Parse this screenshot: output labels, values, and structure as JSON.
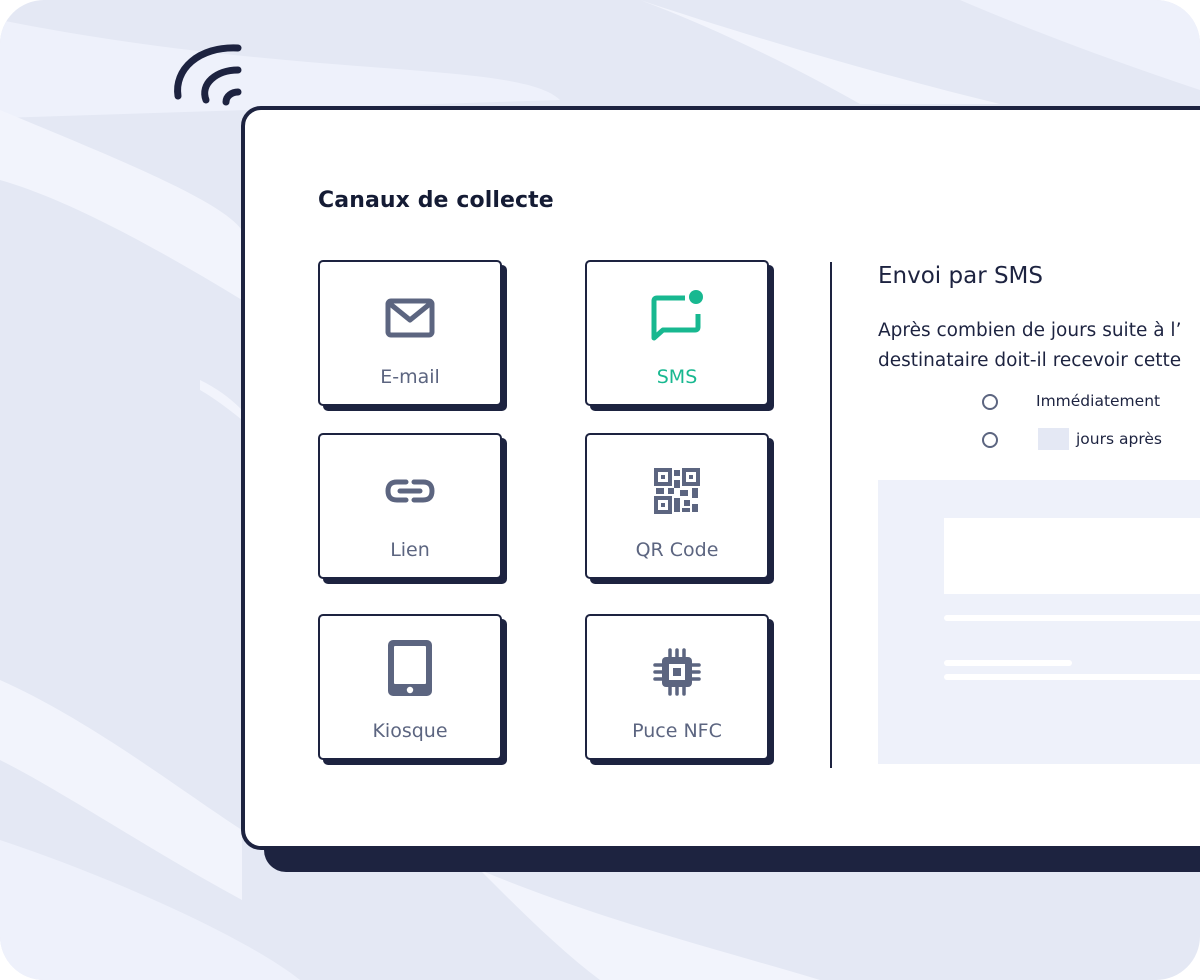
{
  "section": {
    "title": "Canaux de collecte"
  },
  "channels": [
    {
      "label": "E-mail",
      "icon": "envelope-icon",
      "active": false
    },
    {
      "label": "SMS",
      "icon": "chat-notification-icon",
      "active": true
    },
    {
      "label": "Lien",
      "icon": "link-icon",
      "active": false
    },
    {
      "label": "QR Code",
      "icon": "qr-code-icon",
      "active": false
    },
    {
      "label": "Kiosque",
      "icon": "tablet-icon",
      "active": false
    },
    {
      "label": "Puce NFC",
      "icon": "chip-icon",
      "active": false
    }
  ],
  "sms_panel": {
    "title": "Envoi par SMS",
    "question_line1": "Après combien de jours suite à l’",
    "question_line2": "destinataire doit-il recevoir cette",
    "options": [
      {
        "label": "Immédiatement",
        "selected": false
      },
      {
        "label": "jours après",
        "selected": false,
        "days_value": ""
      }
    ]
  },
  "colors": {
    "navy": "#1d2340",
    "accent_green": "#18b890",
    "icon_gray": "#5c6580",
    "background": "#e4e8f4",
    "preview_bg": "#eef1fa"
  }
}
